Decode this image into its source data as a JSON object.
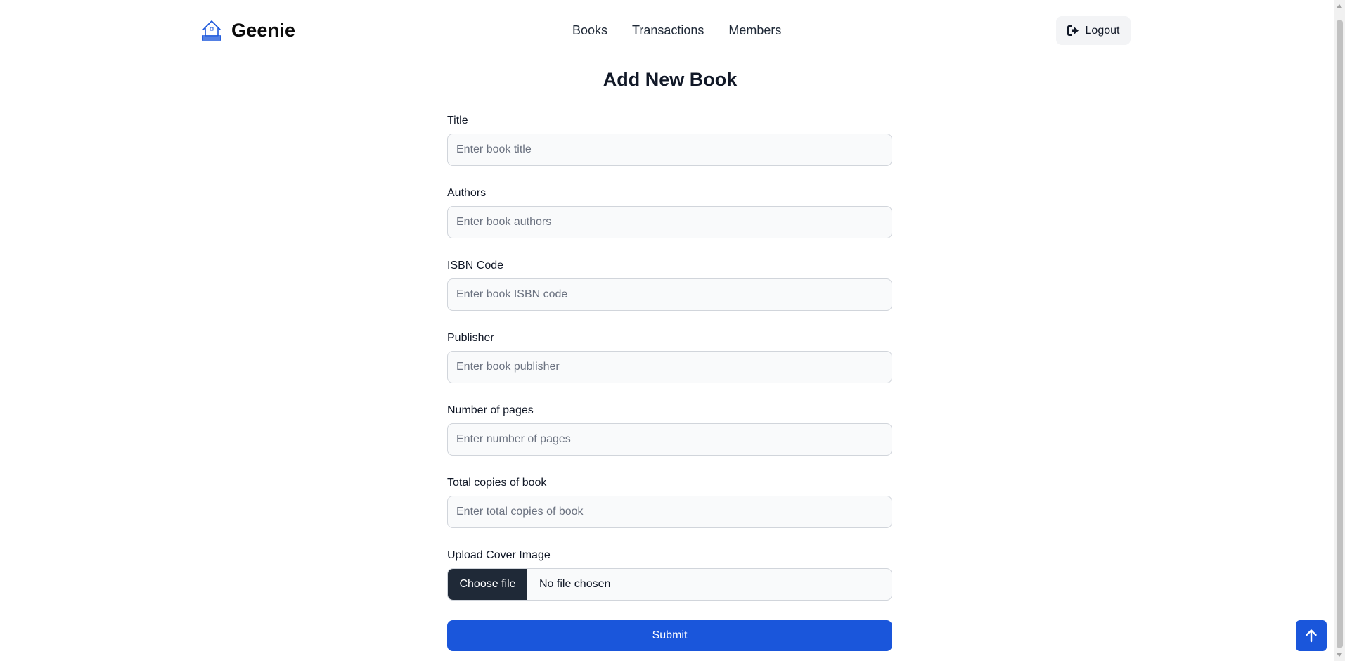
{
  "brand": {
    "name": "Geenie",
    "icon": "house-books-icon",
    "icon_color": "#1a56db"
  },
  "nav": {
    "items": [
      {
        "label": "Books"
      },
      {
        "label": "Transactions"
      },
      {
        "label": "Members"
      }
    ]
  },
  "logout": {
    "label": "Logout",
    "icon": "sign-out-icon"
  },
  "form": {
    "title": "Add New Book",
    "fields": [
      {
        "label": "Title",
        "placeholder": "Enter book title",
        "value": ""
      },
      {
        "label": "Authors",
        "placeholder": "Enter book authors",
        "value": ""
      },
      {
        "label": "ISBN Code",
        "placeholder": "Enter book ISBN code",
        "value": ""
      },
      {
        "label": "Publisher",
        "placeholder": "Enter book publisher",
        "value": ""
      },
      {
        "label": "Number of pages",
        "placeholder": "Enter number of pages",
        "value": ""
      },
      {
        "label": "Total copies of book",
        "placeholder": "Enter total copies of book",
        "value": ""
      }
    ],
    "upload": {
      "label": "Upload Cover Image",
      "button_label": "Choose file",
      "status": "No file chosen"
    },
    "submit_label": "Submit"
  },
  "scroll_to_top": {
    "icon": "arrow-up-icon"
  },
  "colors": {
    "primary": "#1a56db",
    "dark_button": "#1f2937",
    "input_bg": "#f9fafb",
    "input_border": "#d1d5db",
    "logout_bg": "#f3f4f6"
  }
}
